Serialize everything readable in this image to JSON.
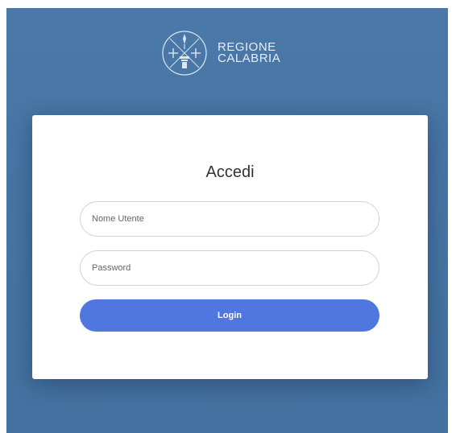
{
  "brand": {
    "logo_icon": "regione-calabria-emblem-icon",
    "line1": "REGIONE",
    "line2": "CALABRIA"
  },
  "login_card": {
    "title": "Accedi",
    "username_placeholder": "Nome Utente",
    "password_placeholder": "Password",
    "login_label": "Login"
  },
  "colors": {
    "background": "#45709f",
    "card": "#ffffff",
    "button": "#5077e0",
    "button_text": "#ffffff"
  }
}
